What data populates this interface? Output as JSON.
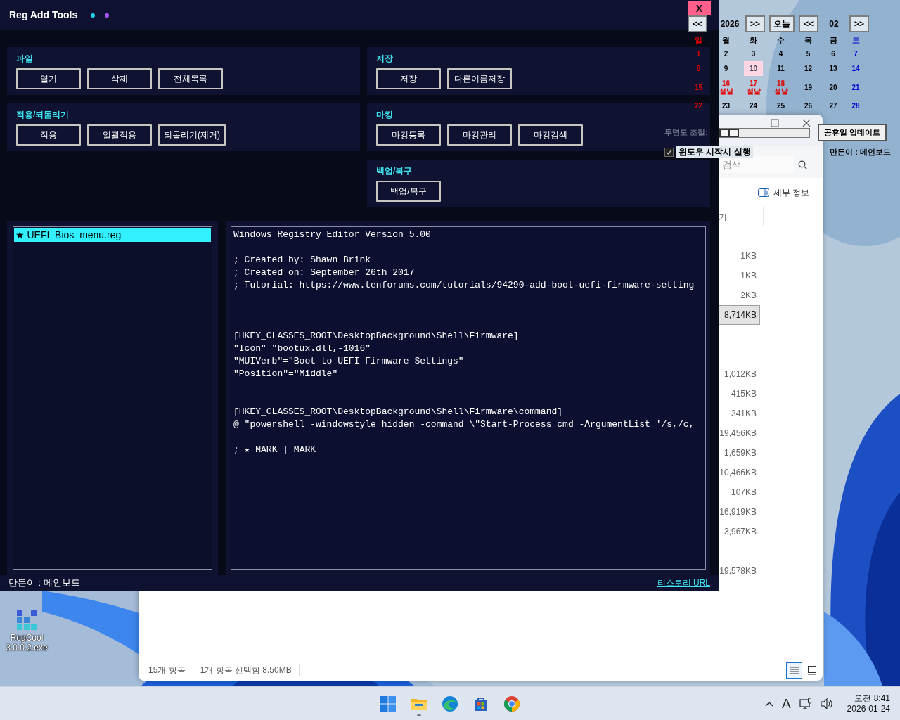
{
  "desktop": {
    "kind": "picture",
    "icons": [
      {
        "label_lines": [
          "RegCool",
          "3.0.0.2.exe"
        ]
      }
    ]
  },
  "explorer": {
    "search": {
      "placeholder": "검색"
    },
    "details_button": "세부 정보",
    "column_header": "기",
    "rows": [
      {
        "size": "1KB",
        "selected": false
      },
      {
        "size": "1KB",
        "selected": false
      },
      {
        "size": "2KB",
        "selected": false
      },
      {
        "size": "8,714KB",
        "selected": true
      },
      {
        "selected": false
      },
      {
        "selected": false
      },
      {
        "size": "1,012KB",
        "selected": false
      },
      {
        "size": "415KB",
        "selected": false
      },
      {
        "size": "341KB",
        "selected": false
      },
      {
        "size": "19,456KB",
        "selected": false
      },
      {
        "size": "1,659KB",
        "selected": false
      },
      {
        "size": "10,466KB",
        "selected": false
      },
      {
        "size": "107KB",
        "selected": false
      },
      {
        "size": "16,919KB",
        "selected": false
      },
      {
        "size": "3,967KB",
        "selected": false
      },
      {
        "selected": false
      },
      {
        "size": "19,578KB",
        "selected": false
      }
    ],
    "status": [
      "15개 항목",
      "1개 항목 선택함 8.50MB"
    ],
    "views": [
      {
        "kind": "details",
        "selected": true
      },
      {
        "kind": "tiles",
        "selected": false
      }
    ]
  },
  "app": {
    "title": "Reg Add Tools",
    "dots": [
      {
        "color": "#22d3ee"
      },
      {
        "color": "#a855f7"
      }
    ],
    "close_label": "X",
    "panels": {
      "left": [
        {
          "title": "파일",
          "buttons": [
            "열기",
            "삭제",
            "전체목록"
          ]
        },
        {
          "title": "적용/되돌리기",
          "buttons": [
            "적용",
            "일괄적용",
            "되돌리기(제거)"
          ]
        }
      ],
      "right": [
        {
          "title": "저장",
          "buttons": [
            "저장",
            "다른이름저장"
          ]
        },
        {
          "title": "마킹",
          "buttons": [
            "마킹등록",
            "마킹관리",
            "마킹검색"
          ]
        },
        {
          "title": "백업/복구",
          "buttons": [
            "백업/복구"
          ]
        }
      ]
    },
    "files": [
      {
        "label": "★ UEFI_Bios_menu.reg",
        "selected": true
      }
    ],
    "editor_lines": [
      {
        "kind": "text",
        "text": "Windows Registry Editor Version 5.00"
      },
      {
        "kind": "blank"
      },
      {
        "kind": "text",
        "text": "; Created by: Shawn Brink"
      },
      {
        "kind": "text",
        "text": "; Created on: September 26th 2017"
      },
      {
        "kind": "text",
        "text": "; Tutorial: https://www.tenforums.com/tutorials/94290-add-boot-uefi-firmware-setting"
      },
      {
        "kind": "blank"
      },
      {
        "kind": "blank"
      },
      {
        "kind": "blank"
      },
      {
        "kind": "text",
        "text": "[HKEY_CLASSES_ROOT\\DesktopBackground\\Shell\\Firmware]"
      },
      {
        "kind": "text",
        "text": "\"Icon\"=\"bootux.dll,-1016\""
      },
      {
        "kind": "text",
        "text": "\"MUIVerb\"=\"Boot to UEFI Firmware Settings\""
      },
      {
        "kind": "text",
        "text": "\"Position\"=\"Middle\""
      },
      {
        "kind": "blank"
      },
      {
        "kind": "blank"
      },
      {
        "kind": "text",
        "text": "[HKEY_CLASSES_ROOT\\DesktopBackground\\Shell\\Firmware\\command]"
      },
      {
        "kind": "text",
        "text": "@=\"powershell -windowstyle hidden -command \\\"Start-Process cmd -ArgumentList '/s,/c,"
      },
      {
        "kind": "blank"
      },
      {
        "kind": "text",
        "text": "; ★ MARK | MARK"
      }
    ],
    "footer": {
      "author": "만든이 : 메인보드",
      "link": "티스토리 URL"
    }
  },
  "calendar": {
    "nav": [
      {
        "kind": "button",
        "label": "<<"
      },
      {
        "kind": "text",
        "label": "2026"
      },
      {
        "kind": "button",
        "label": ">>"
      },
      {
        "kind": "button",
        "label": "오늘"
      },
      {
        "kind": "button",
        "label": "<<"
      },
      {
        "kind": "text",
        "label": "02"
      },
      {
        "kind": "button",
        "label": ">>"
      }
    ],
    "weekdays": [
      {
        "label": "일",
        "kind": "sunday"
      },
      {
        "label": "월",
        "kind": "weekday"
      },
      {
        "label": "화",
        "kind": "weekday"
      },
      {
        "label": "수",
        "kind": "weekday"
      },
      {
        "label": "목",
        "kind": "weekday"
      },
      {
        "label": "금",
        "kind": "weekday"
      },
      {
        "label": "토",
        "kind": "saturday"
      }
    ],
    "weeks": [
      [
        {
          "day": "1",
          "kind": "sunday",
          "today": false
        },
        {
          "day": "2",
          "kind": "weekday",
          "today": false
        },
        {
          "day": "3",
          "kind": "weekday",
          "today": false
        },
        {
          "day": "4",
          "kind": "weekday",
          "today": false
        },
        {
          "day": "5",
          "kind": "weekday",
          "today": false
        },
        {
          "day": "6",
          "kind": "weekday",
          "today": false
        },
        {
          "day": "7",
          "kind": "saturday",
          "today": false
        }
      ],
      [
        {
          "day": "8",
          "kind": "sunday",
          "today": false
        },
        {
          "day": "9",
          "kind": "weekday",
          "today": false
        },
        {
          "day": "10",
          "kind": "weekday",
          "today": true
        },
        {
          "day": "11",
          "kind": "weekday",
          "today": false
        },
        {
          "day": "12",
          "kind": "weekday",
          "today": false
        },
        {
          "day": "13",
          "kind": "weekday",
          "today": false
        },
        {
          "day": "14",
          "kind": "saturday",
          "today": false
        }
      ],
      [
        {
          "day": "15",
          "kind": "sunday",
          "today": false
        },
        {
          "day": "16",
          "kind": "holiday",
          "holiday_name": "설날",
          "today": false
        },
        {
          "day": "17",
          "kind": "holiday",
          "holiday_name": "설날",
          "today": false
        },
        {
          "day": "18",
          "kind": "holiday",
          "holiday_name": "설날",
          "today": false
        },
        {
          "day": "19",
          "kind": "weekday",
          "today": false
        },
        {
          "day": "20",
          "kind": "weekday",
          "today": false
        },
        {
          "day": "21",
          "kind": "saturday",
          "today": false
        }
      ],
      [
        {
          "day": "22",
          "kind": "sunday",
          "today": false
        },
        {
          "day": "23",
          "kind": "weekday",
          "today": false
        },
        {
          "day": "24",
          "kind": "weekday",
          "today": false
        },
        {
          "day": "25",
          "kind": "weekday",
          "today": false
        },
        {
          "day": "26",
          "kind": "weekday",
          "today": false
        },
        {
          "day": "27",
          "kind": "weekday",
          "today": false
        },
        {
          "day": "28",
          "kind": "saturday",
          "today": false
        }
      ]
    ],
    "transparency": {
      "label": "투명도 조절:",
      "level": 0
    },
    "update_button": "공휴일 업데이트",
    "autostart": {
      "label": "윈도우 시작시 실행",
      "checked": true
    },
    "author": "만든이 : 메인보드"
  },
  "taskbar": {
    "apps": [
      {
        "kind": "start",
        "running": false
      },
      {
        "kind": "folder",
        "running": true
      },
      {
        "kind": "edge",
        "running": false
      },
      {
        "kind": "store",
        "running": false
      },
      {
        "kind": "chrome",
        "running": false
      }
    ],
    "ime": "A",
    "time": "오전 8:41",
    "date": "2026-01-24"
  }
}
